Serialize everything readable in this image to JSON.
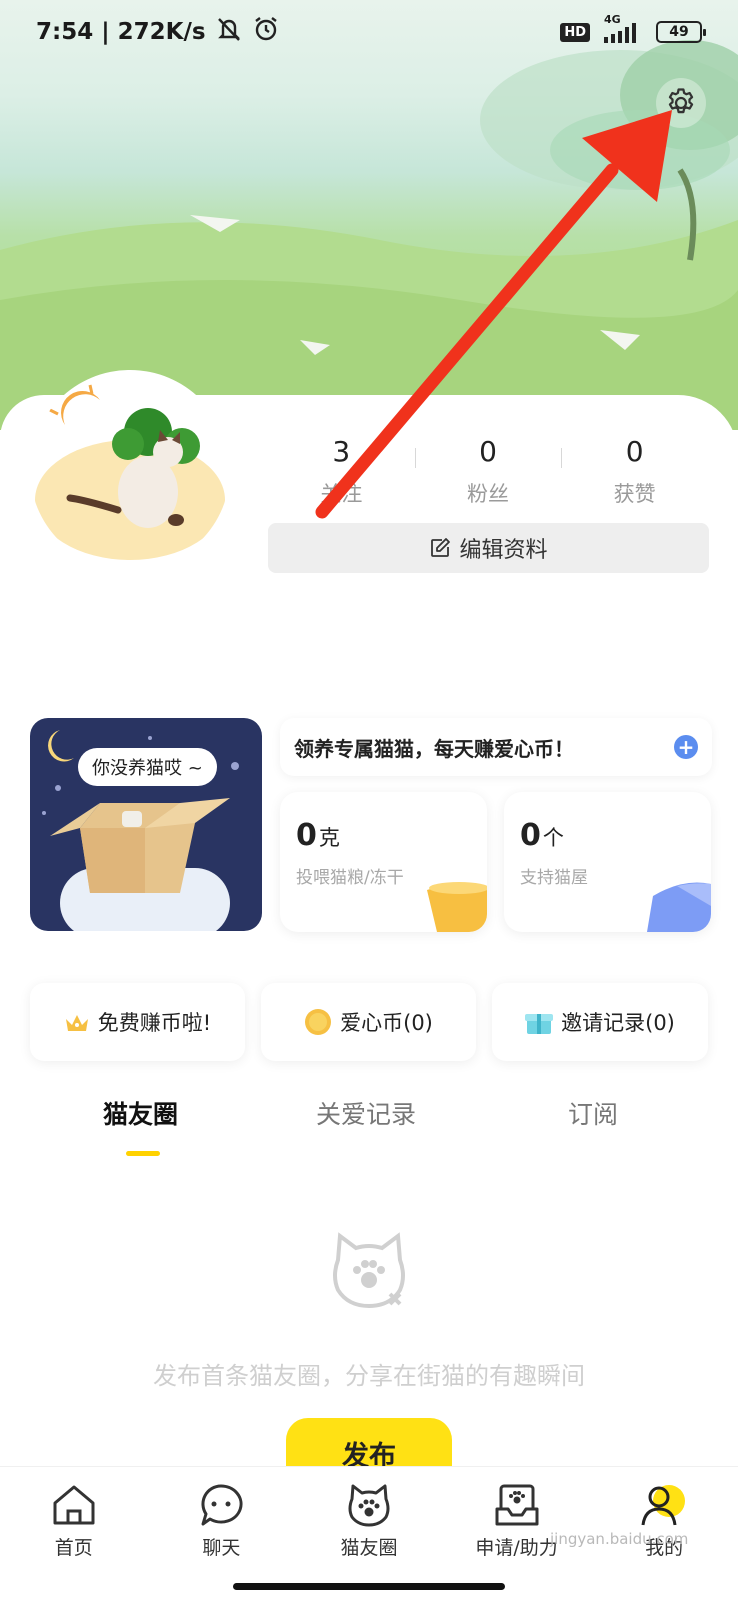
{
  "status_bar": {
    "time": "7:54",
    "separator": "|",
    "net_speed": "272K/s",
    "hd": "HD",
    "net_type": "4G",
    "battery": "49"
  },
  "profile": {
    "stats": [
      {
        "value": "3",
        "label": "关注"
      },
      {
        "value": "0",
        "label": "粉丝"
      },
      {
        "value": "0",
        "label": "获赞"
      }
    ],
    "edit_label": "编辑资料"
  },
  "adoption": {
    "bubble_text": "你没养猫哎 ~",
    "promo_text": "领养专属猫猫，每天赚爱心币！",
    "food": {
      "value": "0",
      "unit": "克",
      "desc": "投喂猫粮/冻干"
    },
    "house": {
      "value": "0",
      "unit": "个",
      "desc": "支持猫屋"
    }
  },
  "chips": [
    {
      "label": "免费赚币啦!"
    },
    {
      "label": "爱心币(0)"
    },
    {
      "label": "邀请记录(0)"
    }
  ],
  "tabs": [
    {
      "label": "猫友圈",
      "active": true
    },
    {
      "label": "关爱记录",
      "active": false
    },
    {
      "label": "订阅",
      "active": false
    }
  ],
  "empty_state": {
    "text": "发布首条猫友圈，分享在街猫的有趣瞬间",
    "button": "发布"
  },
  "bottom_nav": [
    {
      "label": "首页",
      "icon": "home-icon"
    },
    {
      "label": "聊天",
      "icon": "chat-icon"
    },
    {
      "label": "猫友圈",
      "icon": "cat-paw-icon"
    },
    {
      "label": "申请/助力",
      "icon": "apply-inbox-icon"
    },
    {
      "label": "我的",
      "icon": "profile-icon",
      "active": true
    }
  ],
  "watermark": "jingyan.baidu.com",
  "colors": {
    "accent_yellow": "#ffe114",
    "tab_indicator": "#ffd200",
    "annotation_arrow": "#f0321c",
    "adopt_card_bg": "#293462"
  }
}
